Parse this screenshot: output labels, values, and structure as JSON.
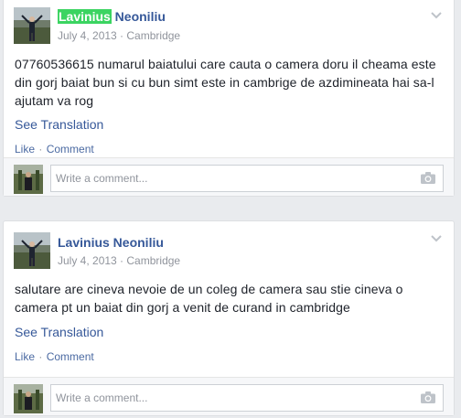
{
  "posts": [
    {
      "author_first": "Lavinius",
      "author_rest": " Neoniliu",
      "date": "July 4, 2013",
      "separator": " · ",
      "location": "Cambridge",
      "lines": [
        "07760536615 numarul baiatului care cauta o camera doru il cheama este",
        "din gorj baiat bun si cu bun simt este in cambrige de azdimineata hai sa-l",
        "ajutam va rog"
      ],
      "see_translation": "See Translation",
      "like": "Like",
      "dot": " · ",
      "comment": "Comment",
      "comment_placeholder": "Write a comment..."
    },
    {
      "author_first": "Lavinius",
      "author_rest": " Neoniliu",
      "date": "July 4, 2013",
      "separator": " · ",
      "location": "Cambridge",
      "lines": [
        "salutare are cineva nevoie de un coleg de camera sau stie cineva o",
        "camera pt un baiat din gorj a venit de curand in cambridge"
      ],
      "see_translation": "See Translation",
      "like": "Like",
      "dot": " · ",
      "comment": "Comment",
      "comment_placeholder": "Write a comment..."
    }
  ],
  "colors": {
    "link": "#365899",
    "highlight": "#3bd461",
    "meta": "#90949c",
    "background": "#e9ebee"
  }
}
